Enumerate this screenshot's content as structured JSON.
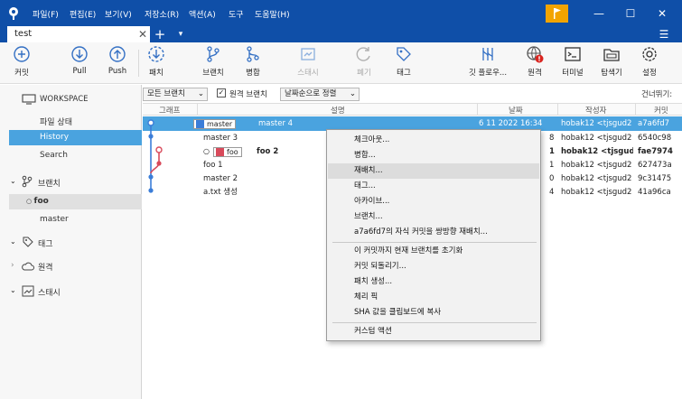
{
  "menu": [
    "파일(F)",
    "편집(E)",
    "보기(V)",
    "저장소(R)",
    "액션(A)",
    "도구",
    "도움말(H)"
  ],
  "window_controls": {
    "minimize": "—",
    "maximize": "☐",
    "close": "✕"
  },
  "tab": {
    "title": "test",
    "close": "✕",
    "add": "+",
    "more": "▾",
    "menu": "☰"
  },
  "toolbar": {
    "commit": "커밋",
    "pull": "Pull",
    "push": "Push",
    "patch": "패치",
    "branch": "브랜치",
    "merge": "병합",
    "stash": "스태시",
    "discard": "폐기",
    "tag": "태그",
    "gitflow": "깃 플로우...",
    "remote": "원격",
    "terminal": "터미널",
    "explorer": "탐색기",
    "settings": "설정"
  },
  "sidebar": {
    "workspace": "WORKSPACE",
    "file_status": "파일 상태",
    "history": "History",
    "search": "Search",
    "branches": "브랜치",
    "branch_foo": "foo",
    "branch_master": "master",
    "tags": "태그",
    "remotes": "원격",
    "stashes": "스태시"
  },
  "filters": {
    "branches": "모든 브랜치",
    "remote_branches": "원격 브랜치",
    "sort": "날짜순으로 정렬",
    "jump": "건너뛰기:"
  },
  "columns": {
    "graph": "그래프",
    "description": "설명",
    "date": "날짜",
    "author": "작성자",
    "commit": "커밋"
  },
  "commits": [
    {
      "tag": "master",
      "message": "master 4",
      "date": "6 11 2022 16:34",
      "author": "hobak12 <tjsgud2",
      "hash": "a7a6fd7"
    },
    {
      "tag": "",
      "message": "master 3",
      "date": "8",
      "author": "hobak12 <tjsgud2",
      "hash": "6540c98"
    },
    {
      "tag": "foo",
      "message": "foo 2",
      "date": "1",
      "author": "hobak12 <tjsgud",
      "hash": "fae7974"
    },
    {
      "tag": "",
      "message": "foo 1",
      "date": "1",
      "author": "hobak12 <tjsgud2",
      "hash": "627473a"
    },
    {
      "tag": "",
      "message": "master 2",
      "date": "0",
      "author": "hobak12 <tjsgud2",
      "hash": "9c31475"
    },
    {
      "tag": "",
      "message": "a.txt 생성",
      "date": "4",
      "author": "hobak12 <tjsgud2",
      "hash": "41a96ca"
    }
  ],
  "context_menu": [
    "체크아웃...",
    "병합...",
    "재배치...",
    "태그...",
    "아카이브...",
    "브랜치...",
    "a7a6fd7의 자식 커밋을 쌍방향 재배치...",
    "이 커밋까지 현재 브랜치를 초기화",
    "커밋 되돌리기...",
    "패치 생성...",
    "체리 픽",
    "SHA 값을 클립보드에 복사",
    "커스텀 액션"
  ],
  "colors": {
    "titlebar": "#0f4fa8",
    "selection": "#4aa3df",
    "flag": "#f2a400",
    "branch_blue": "#3b7dd8",
    "branch_red": "#d84a5b"
  }
}
